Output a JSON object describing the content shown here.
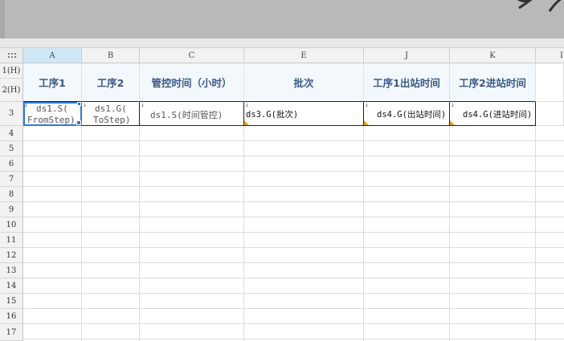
{
  "columns": [
    {
      "letter": "A"
    },
    {
      "letter": "B"
    },
    {
      "letter": "C"
    },
    {
      "letter": "E"
    },
    {
      "letter": "J"
    },
    {
      "letter": "K"
    },
    {
      "letter": "I"
    }
  ],
  "rows": [
    "1(H)",
    "2(H)",
    "3",
    "4",
    "5",
    "6",
    "7",
    "8",
    "9",
    "10",
    "11",
    "12",
    "13",
    "14",
    "15",
    "16",
    "17"
  ],
  "header_cells": [
    "工序1",
    "工序2",
    "管控时间（小时）",
    "批次",
    "工序1出站时间",
    "工序2进站时间"
  ],
  "data_cells": [
    {
      "line1": "ds1.S(",
      "line2": "FromStep)"
    },
    {
      "line1": "ds1.G(",
      "line2": "ToStep)"
    },
    {
      "line1": "ds1.S(时间管控)"
    },
    {
      "line1": "ds3.G(批次)"
    },
    {
      "line1": "ds4.G(出站时间)"
    },
    {
      "line1": "ds4.G(进站时间)"
    }
  ],
  "selected_cell": "A3",
  "colors": {
    "header_text": "#3a5a86",
    "selection": "#2b7bd3",
    "corner_marker": "#e6a21c"
  }
}
